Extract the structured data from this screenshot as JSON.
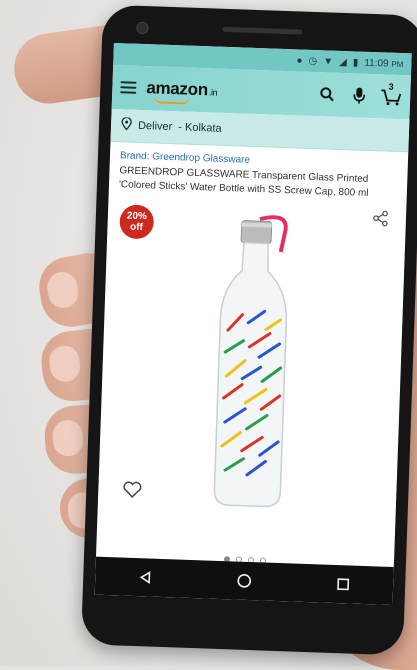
{
  "status_bar": {
    "time": "11:09",
    "ampm": "PM",
    "icons": [
      "location-icon",
      "alarm-icon",
      "wifi-icon",
      "signal-icon",
      "battery-icon"
    ]
  },
  "header": {
    "logo_text": "amazon",
    "logo_suffix": ".in",
    "cart_count": "3",
    "icons": [
      "menu-icon",
      "search-icon",
      "mic-icon",
      "cart-icon"
    ]
  },
  "deliver": {
    "label": "Deliver",
    "location": "- Kolkata"
  },
  "product": {
    "brand": "Brand: Greendrop Glassware",
    "title": "GREENDROP GLASSWARE Transparent Glass Printed 'Colored Sticks' Water Bottle with SS Screw Cap, 800 ml",
    "discount_percent": "20%",
    "discount_off": "off",
    "image_count": 4,
    "active_image": 0
  },
  "colors": {
    "header_teal": "#86d3cf",
    "deliver_bg": "#c9ebe7",
    "badge_red": "#cc2a1f",
    "brand_link": "#2a6fb0",
    "strap_pink": "#e2315f"
  },
  "nav": {
    "icons": [
      "back-icon",
      "home-icon",
      "recents-icon"
    ]
  }
}
